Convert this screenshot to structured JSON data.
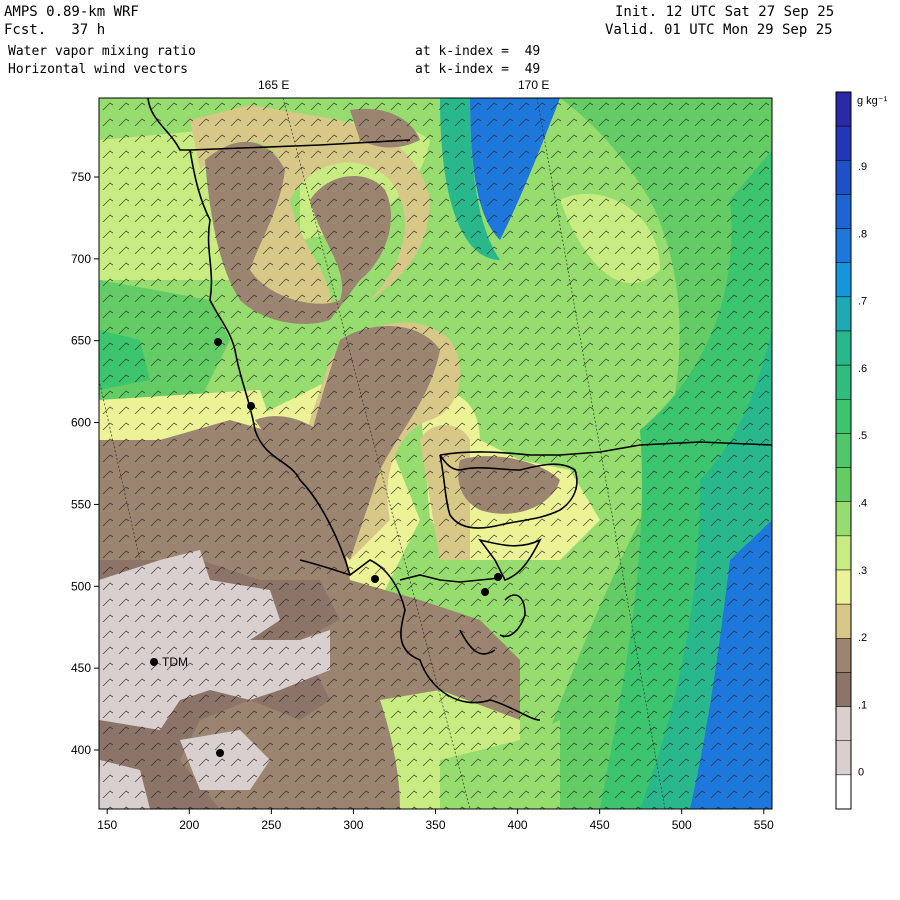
{
  "header": {
    "model": "AMPS 0.89-km WRF",
    "forecast": "Fcst.   37 h",
    "field1": "Water vapor mixing ratio",
    "field2": "Horizontal wind vectors",
    "kindex1": "at k-index =  49",
    "kindex2": "at k-index =  49",
    "init": "Init. 12 UTC Sat 27 Sep 25",
    "valid": "Valid. 01 UTC Mon 29 Sep 25"
  },
  "longitude_labels": [
    "165 E",
    "170 E"
  ],
  "axes": {
    "x_ticks": [
      "150",
      "200",
      "250",
      "300",
      "350",
      "400",
      "450",
      "500",
      "550"
    ],
    "y_ticks": [
      "750",
      "700",
      "650",
      "600",
      "550",
      "500",
      "450",
      "400"
    ]
  },
  "colorbar": {
    "unit": "g kg⁻¹",
    "labels": [
      ".9",
      ".8",
      ".7",
      ".6",
      ".5",
      ".4",
      ".3",
      ".2",
      ".1",
      "0"
    ],
    "colors": [
      "#2a2aa8",
      "#1e50c8",
      "#1e78dc",
      "#1496dc",
      "#1eaab4",
      "#28b88c",
      "#3cc46e",
      "#64cc64",
      "#96dc6e",
      "#c8ec82",
      "#ecf296",
      "#d7c888",
      "#9b8470",
      "#8c7468",
      "#d9cfcf",
      "#ffffff"
    ],
    "color_levels": [
      "1.0",
      ".95",
      ".9",
      ".85",
      ".8",
      ".75",
      ".7",
      ".65",
      ".6",
      ".55",
      ".5",
      ".45",
      ".4",
      ".35",
      ".3",
      ".25",
      ".2",
      ".15",
      ".1",
      ".05",
      "0"
    ]
  },
  "stations": [
    {
      "label": "TDM"
    }
  ]
}
